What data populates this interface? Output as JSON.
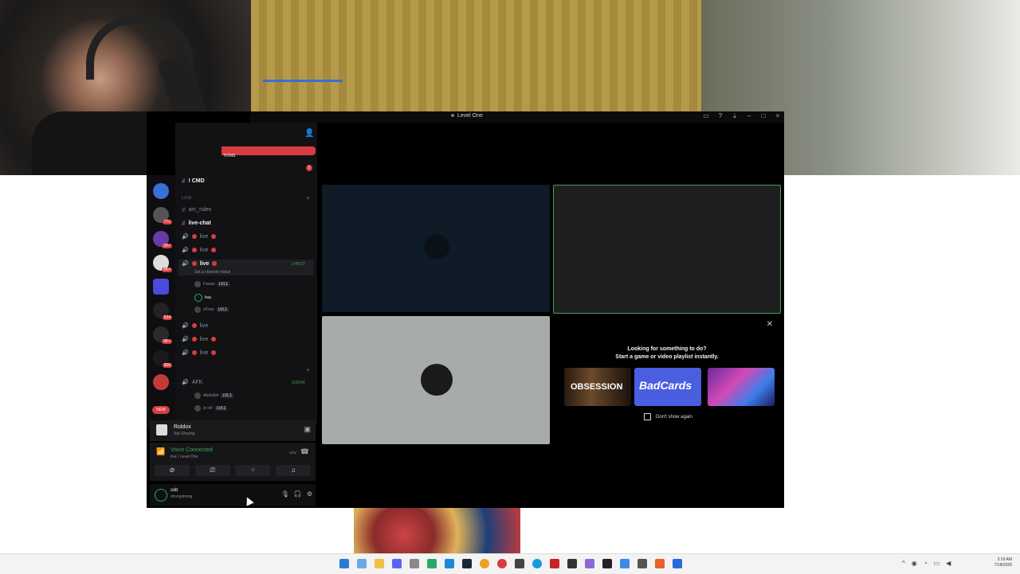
{
  "window": {
    "title": "Level One"
  },
  "notif": {
    "label": "TIONS",
    "count": "2"
  },
  "channels": [
    {
      "name": "! CMD",
      "bright": true
    },
    {
      "section": "LIVE"
    },
    {
      "name": "arc_rules"
    },
    {
      "name": "live-chat",
      "bright": true
    },
    {
      "name": "live"
    },
    {
      "name": "live"
    },
    {
      "name": "live",
      "timer": "2:49:27",
      "status": "Set a channel status"
    },
    {
      "name": "live"
    },
    {
      "name": "live"
    },
    {
      "name": "live"
    },
    {
      "name": "AFK",
      "timer": "3:09:04"
    }
  ],
  "members": [
    {
      "name": "Fawaz",
      "level": "LVL1"
    },
    {
      "name": "ksa"
    },
    {
      "name": "vFiras",
      "level": "LVL1"
    },
    {
      "name": "Abdullah",
      "level": "LVL1"
    },
    {
      "name": "br-oF",
      "level": "LVL1"
    }
  ],
  "guilds": {
    "badges": [
      "771",
      "2K+",
      "4K+",
      "534",
      "9K+",
      "906"
    ],
    "new_label": "NEW"
  },
  "activity": {
    "title": "Roblox",
    "sub": "Not Sharing"
  },
  "voice": {
    "title": "Voice Connected",
    "sub": "live / Level One"
  },
  "user": {
    "name": "sxb",
    "tag": "shongxbong"
  },
  "suggest": {
    "title": "Looking for something to do?",
    "sub": "Start a game or video playlist instantly.",
    "cards": [
      "OBSESSION",
      "BadCards",
      ""
    ],
    "checkbox": "Don't show again"
  },
  "clock": {
    "time": "3:19 AM",
    "date": "7/18/2026"
  },
  "icons": [
    "search-icon",
    "add-user-icon",
    "close-icon",
    "speaker-icon",
    "gear-icon",
    "mic-icon",
    "headphones-icon"
  ]
}
